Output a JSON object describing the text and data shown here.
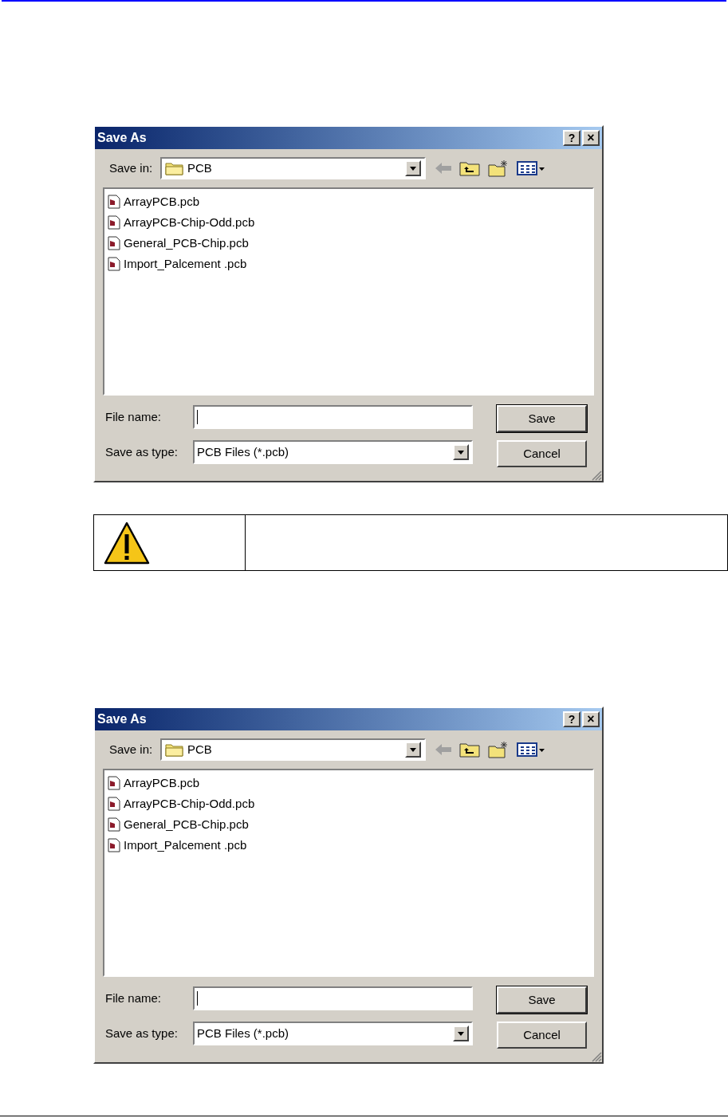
{
  "dialogs": [
    {
      "title": "Save As",
      "help_button": "?",
      "close_button": "×",
      "save_in_label": "Save in:",
      "save_in_folder": "PCB",
      "files": [
        "ArrayPCB.pcb",
        "ArrayPCB-Chip-Odd.pcb",
        "General_PCB-Chip.pcb",
        "Import_Palcement .pcb"
      ],
      "file_name_label": "File name:",
      "save_as_type_label": "Save as type:",
      "save_as_type": "PCB Files (*.pcb)",
      "buttons": [
        "Save",
        "Cancel"
      ]
    },
    {
      "title": "Save As",
      "help_button": "?",
      "close_button": "×",
      "save_in_label": "Save in:",
      "save_in_folder": "PCB",
      "files": [
        "ArrayPCB.pcb",
        "ArrayPCB-Chip-Odd.pcb",
        "General_PCB-Chip.pcb",
        "Import_Palcement .pcb"
      ],
      "file_name_label": "File name:",
      "save_as_type_label": "Save as type:",
      "save_as_type": "PCB Files (*.pcb)",
      "buttons": [
        "Save",
        "Cancel"
      ]
    }
  ]
}
